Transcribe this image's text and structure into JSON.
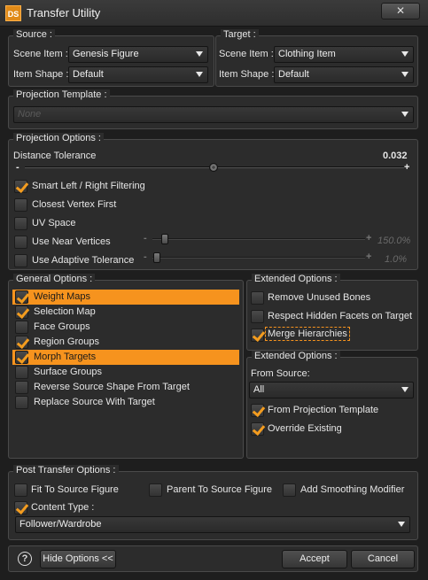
{
  "window": {
    "title": "Transfer Utility",
    "logo": "DS",
    "close_glyph": "✕"
  },
  "source": {
    "title": "Source :",
    "scene_item_label": "Scene Item :",
    "scene_item_value": "Genesis Figure",
    "item_shape_label": "Item Shape :",
    "item_shape_value": "Default"
  },
  "target": {
    "title": "Target :",
    "scene_item_label": "Scene Item :",
    "scene_item_value": "Clothing Item",
    "item_shape_label": "Item Shape :",
    "item_shape_value": "Default"
  },
  "projection_template": {
    "title": "Projection Template :",
    "value": "None"
  },
  "projection_options": {
    "title": "Projection Options :",
    "distance_label": "Distance Tolerance",
    "distance_value": "0.032",
    "minus": "-",
    "plus": "+",
    "smart_filtering": {
      "label": "Smart Left / Right Filtering",
      "checked": true
    },
    "closest_vertex": {
      "label": "Closest Vertex First",
      "checked": false
    },
    "uv_space": {
      "label": "UV Space",
      "checked": false
    },
    "near_vertices": {
      "label": "Use Near Vertices",
      "checked": false,
      "value": "150.0%"
    },
    "adaptive_tolerance": {
      "label": "Use Adaptive Tolerance",
      "checked": false,
      "value": "1.0%"
    }
  },
  "general_options": {
    "title": "General Options :",
    "items": [
      {
        "label": "Weight Maps",
        "checked": true,
        "highlighted": true
      },
      {
        "label": "Selection Map",
        "checked": true,
        "highlighted": false
      },
      {
        "label": "Face Groups",
        "checked": false,
        "highlighted": false
      },
      {
        "label": "Region Groups",
        "checked": true,
        "highlighted": false
      },
      {
        "label": "Morph Targets",
        "checked": true,
        "highlighted": true
      },
      {
        "label": "Surface Groups",
        "checked": false,
        "highlighted": false
      },
      {
        "label": "Reverse Source Shape From Target",
        "checked": false,
        "highlighted": false
      },
      {
        "label": "Replace Source With Target",
        "checked": false,
        "highlighted": false
      }
    ]
  },
  "extended_options": {
    "title": "Extended Options :",
    "remove_unused_bones": {
      "label": "Remove Unused Bones",
      "checked": false
    },
    "respect_hidden_facets": {
      "label": "Respect Hidden Facets on Target",
      "checked": false
    },
    "merge_hierarchies": {
      "label": "Merge Hierarchies",
      "checked": true
    }
  },
  "extended_options_2": {
    "title": "Extended Options :",
    "from_source_label": "From Source:",
    "from_source_value": "All",
    "from_projection_template": {
      "label": "From Projection Template",
      "checked": true
    },
    "override_existing": {
      "label": "Override Existing",
      "checked": true
    }
  },
  "post_transfer": {
    "title": "Post Transfer Options :",
    "fit_to_source": {
      "label": "Fit To Source Figure",
      "checked": false
    },
    "parent_to_source": {
      "label": "Parent To Source Figure",
      "checked": false
    },
    "add_smoothing": {
      "label": "Add Smoothing Modifier",
      "checked": false
    },
    "content_type": {
      "label": "Content Type :",
      "checked": true
    },
    "content_type_value": "Follower/Wardrobe"
  },
  "footer": {
    "help_glyph": "?",
    "hide_options_label": "Hide Options <<",
    "accept_label": "Accept",
    "cancel_label": "Cancel"
  }
}
